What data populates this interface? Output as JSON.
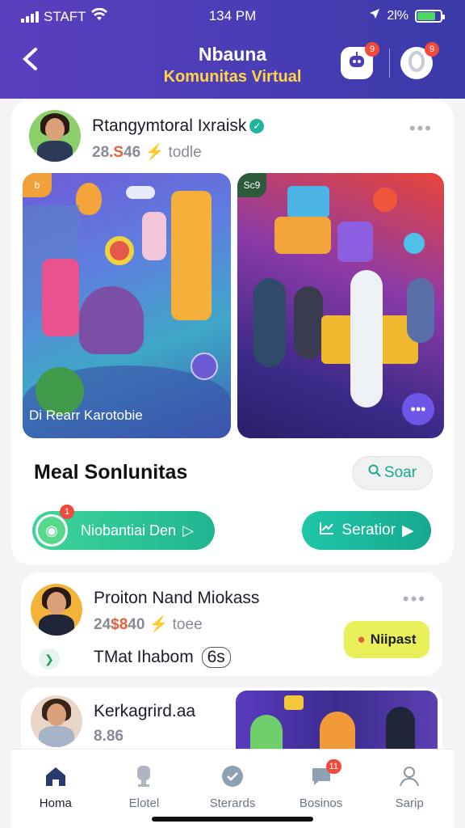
{
  "status": {
    "carrier": "STAFT",
    "time": "134 PM",
    "battery_text": "2l%",
    "battery_level": 0.8
  },
  "header": {
    "title": "Nbauna",
    "subtitle": "Komunitas Virtual",
    "bot_badge": "9",
    "ring_badge": "9"
  },
  "post": {
    "author": "Rtangymtoral Ixraisk",
    "count": "28",
    "count_hot": ".S",
    "count_tail": "46",
    "meta_label": "todle",
    "image1_tag": "b",
    "image1_caption": "Di Rearr Karotobie",
    "image2_tag": "Sc9"
  },
  "community": {
    "title": "Meal Sonlunitas",
    "search_label": "Soar",
    "join_label": "Niobantiai Den",
    "join_badge": "1",
    "stats_label": "Seratior"
  },
  "card2": {
    "author": "Proiton Nand Miokass",
    "count": "24",
    "count_hot": "$8",
    "count_tail": "40",
    "meta_label": "toee",
    "badge_label": "Niipast",
    "tag_text": "TMat Ihabom",
    "tag_suffix": "6s"
  },
  "card3": {
    "author": "Kerkagrird.aa",
    "count": "8.86"
  },
  "nav": {
    "items": [
      {
        "label": "Homa",
        "icon": "home-icon"
      },
      {
        "label": "Elotel",
        "icon": "trophy-icon"
      },
      {
        "label": "Sterards",
        "icon": "badge-icon"
      },
      {
        "label": "Bosinos",
        "icon": "chat-icon",
        "badge": "11"
      },
      {
        "label": "Sarip",
        "icon": "profile-icon"
      }
    ]
  },
  "colors": {
    "header": "#4a3db5",
    "accent": "#1fb59a",
    "highlight": "#ffd54a"
  }
}
